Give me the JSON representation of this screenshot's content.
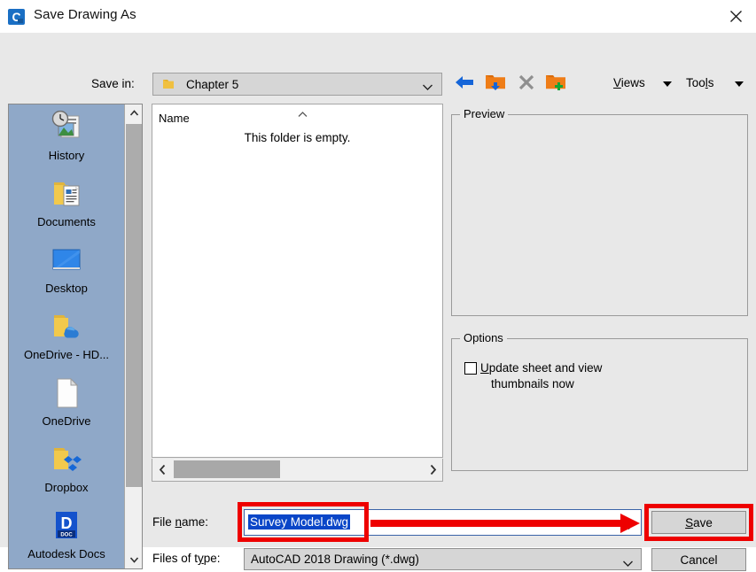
{
  "window": {
    "title": "Save Drawing As",
    "app_icon": "autocad-icon",
    "close_label": "✕"
  },
  "toolbar": {
    "save_in_label": "Save in:",
    "save_in_value": "Chapter 5",
    "buttons": [
      {
        "name": "back-button",
        "icon": "back-arrow-icon"
      },
      {
        "name": "up-one-level-button",
        "icon": "folder-up-icon"
      },
      {
        "name": "delete-button",
        "icon": "close-x-icon"
      },
      {
        "name": "new-folder-button",
        "icon": "folder-new-icon"
      }
    ],
    "views_label": "Views",
    "tools_label": "Tools"
  },
  "places": {
    "items": [
      {
        "label": "History",
        "icon": "history-icon"
      },
      {
        "label": "Documents",
        "icon": "documents-folder-icon"
      },
      {
        "label": "Desktop",
        "icon": "desktop-icon"
      },
      {
        "label": "OneDrive - HD...",
        "icon": "onedrive-folder-icon"
      },
      {
        "label": "OneDrive",
        "icon": "document-page-icon"
      },
      {
        "label": "Dropbox",
        "icon": "dropbox-folder-icon"
      },
      {
        "label": "Autodesk Docs",
        "icon": "autodesk-docs-icon"
      }
    ]
  },
  "filelist": {
    "column_name": "Name",
    "sort_indicator": "sort-ascending-icon",
    "empty_message": "This folder is empty.",
    "scroll_left": "‹",
    "scroll_right": "›"
  },
  "preview": {
    "title": "Preview"
  },
  "options": {
    "title": "Options",
    "checkbox_label_underlined": "U",
    "checkbox_label_line1": "pdate sheet and view",
    "checkbox_label_line2": "thumbnails now",
    "checkbox_checked": false
  },
  "bottom": {
    "file_name_label_pre": "File ",
    "file_name_label_underlined": "n",
    "file_name_label_post": "ame:",
    "file_name_value": "Survey Model.dwg",
    "files_of_type_label_pre": "Files of t",
    "files_of_type_label_underlined": "y",
    "files_of_type_label_post": "pe:",
    "files_of_type_value": "AutoCAD 2018 Drawing (*.dwg)",
    "save_label_underlined": "S",
    "save_label_post": "ave",
    "cancel_label": "Cancel"
  },
  "annotations": {
    "highlight_color": "#ee0000",
    "targets": [
      "file-name-field",
      "save-button"
    ]
  }
}
